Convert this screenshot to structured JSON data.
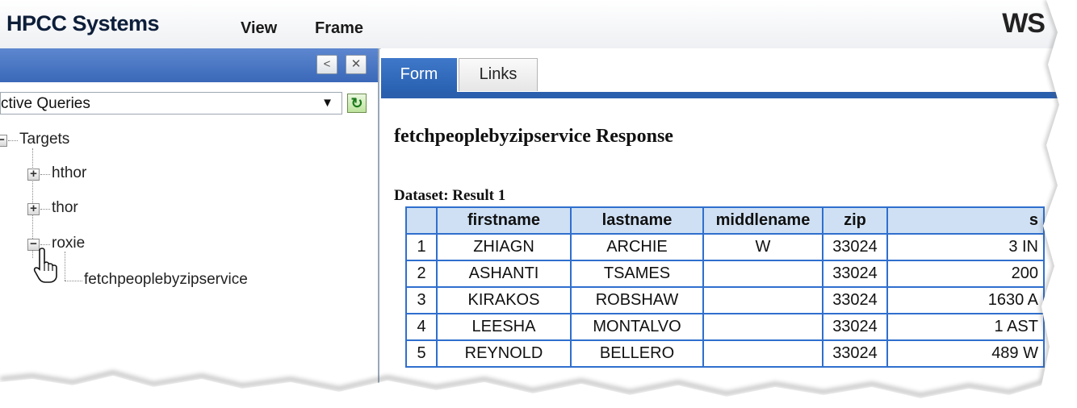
{
  "topbar": {
    "brand": "HPCC Systems",
    "menu": [
      "View",
      "Frame"
    ],
    "brand_right": "WS"
  },
  "left_panel": {
    "header_buttons": [
      "<",
      "✕"
    ],
    "query_select": "ctive Queries",
    "refresh_icon": "refresh-icon",
    "tree": {
      "root": "Targets",
      "nodes": [
        {
          "label": "hthor",
          "state": "+"
        },
        {
          "label": "thor",
          "state": "+"
        },
        {
          "label": "roxie",
          "state": "−"
        }
      ],
      "leaf": "fetchpeoplebyzipservice"
    }
  },
  "tabs": [
    "Form",
    "Links"
  ],
  "response_title": "fetchpeoplebyzipservice Response",
  "dataset_label": "Dataset: Result 1",
  "table": {
    "headers": [
      "",
      "firstname",
      "lastname",
      "middlename",
      "zip",
      "s"
    ],
    "rows": [
      [
        "1",
        "ZHIAGN",
        "ARCHIE",
        "W",
        "33024",
        "3 IN"
      ],
      [
        "2",
        "ASHANTI",
        "TSAMES",
        "",
        "33024",
        "200"
      ],
      [
        "3",
        "KIRAKOS",
        "ROBSHAW",
        "",
        "33024",
        "1630 A"
      ],
      [
        "4",
        "LEESHA",
        "MONTALVO",
        "",
        "33024",
        "1 AST"
      ],
      [
        "5",
        "REYNOLD",
        "BELLERO",
        "",
        "33024",
        "489 W"
      ]
    ]
  },
  "colors": {
    "accent": "#2a5fae",
    "header_bg": "#3a68b8",
    "table_border": "#2f6fce"
  }
}
